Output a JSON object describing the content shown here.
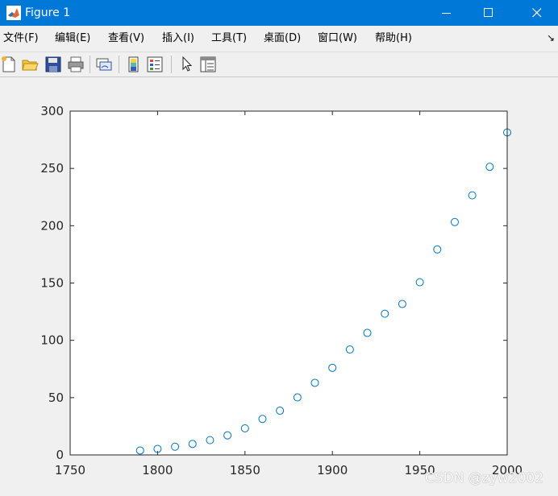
{
  "window": {
    "title": "Figure 1"
  },
  "menu": [
    "文件(F)",
    "编辑(E)",
    "查看(V)",
    "插入(I)",
    "工具(T)",
    "桌面(D)",
    "窗口(W)",
    "帮助(H)"
  ],
  "toolbar": [
    "new-figure",
    "open-file",
    "save",
    "print",
    "link-plot",
    "insert-colorbar",
    "insert-legend",
    "edit-plot",
    "property-inspector"
  ],
  "chart_data": {
    "type": "scatter",
    "marker": "open-circle",
    "color": "#0072bd",
    "x": [
      1790,
      1800,
      1810,
      1820,
      1830,
      1840,
      1850,
      1860,
      1870,
      1880,
      1890,
      1900,
      1910,
      1920,
      1930,
      1940,
      1950,
      1960,
      1970,
      1980,
      1990,
      2000
    ],
    "y": [
      3.9,
      5.3,
      7.2,
      9.6,
      12.9,
      17.1,
      23.2,
      31.4,
      38.6,
      50.2,
      62.9,
      76.0,
      92.0,
      106.5,
      123.2,
      131.7,
      150.7,
      179.3,
      203.2,
      226.5,
      251.4,
      281.4
    ],
    "xlim": [
      1750,
      2000
    ],
    "ylim": [
      0,
      300
    ],
    "xticks": [
      "1750",
      "1800",
      "1850",
      "1900",
      "1950",
      "2000"
    ],
    "yticks": [
      "0",
      "50",
      "100",
      "150",
      "200",
      "250",
      "300"
    ],
    "title": "",
    "xlabel": "",
    "ylabel": "",
    "grid": false
  },
  "watermark": "CSDN @zyw2002"
}
